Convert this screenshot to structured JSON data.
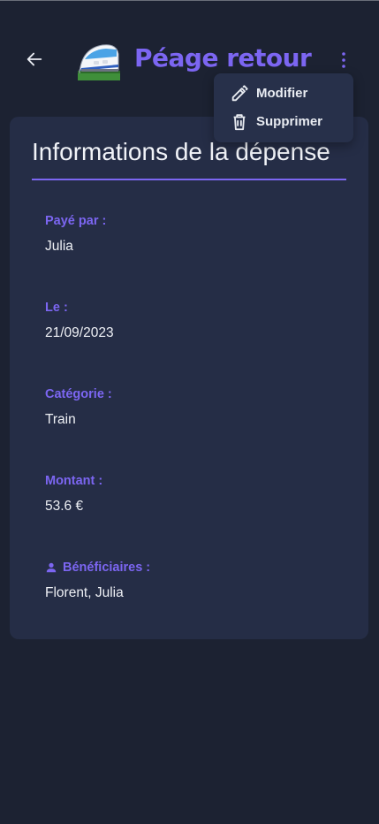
{
  "header": {
    "title": "Péage retour",
    "back_icon": "arrow-left-icon",
    "emoji_icon": "high-speed-train-icon",
    "more_icon": "more-vertical-icon"
  },
  "menu": {
    "items": [
      {
        "label": "Modifier",
        "icon": "pencil-icon"
      },
      {
        "label": "Supprimer",
        "icon": "trash-icon"
      }
    ]
  },
  "card": {
    "title": "Informations de la dépense",
    "fields": [
      {
        "label": "Payé par :",
        "value": "Julia"
      },
      {
        "label": "Le :",
        "value": "21/09/2023"
      },
      {
        "label": "Catégorie :",
        "value": "Train"
      },
      {
        "label": "Montant :",
        "value": "53.6 €"
      },
      {
        "label": "Bénéficiaires :",
        "value": "Florent, Julia",
        "icon": "person-icon"
      }
    ]
  },
  "colors": {
    "background": "#1c2232",
    "card": "#252d46",
    "accent": "#7c66f2",
    "menu": "#27304a"
  }
}
